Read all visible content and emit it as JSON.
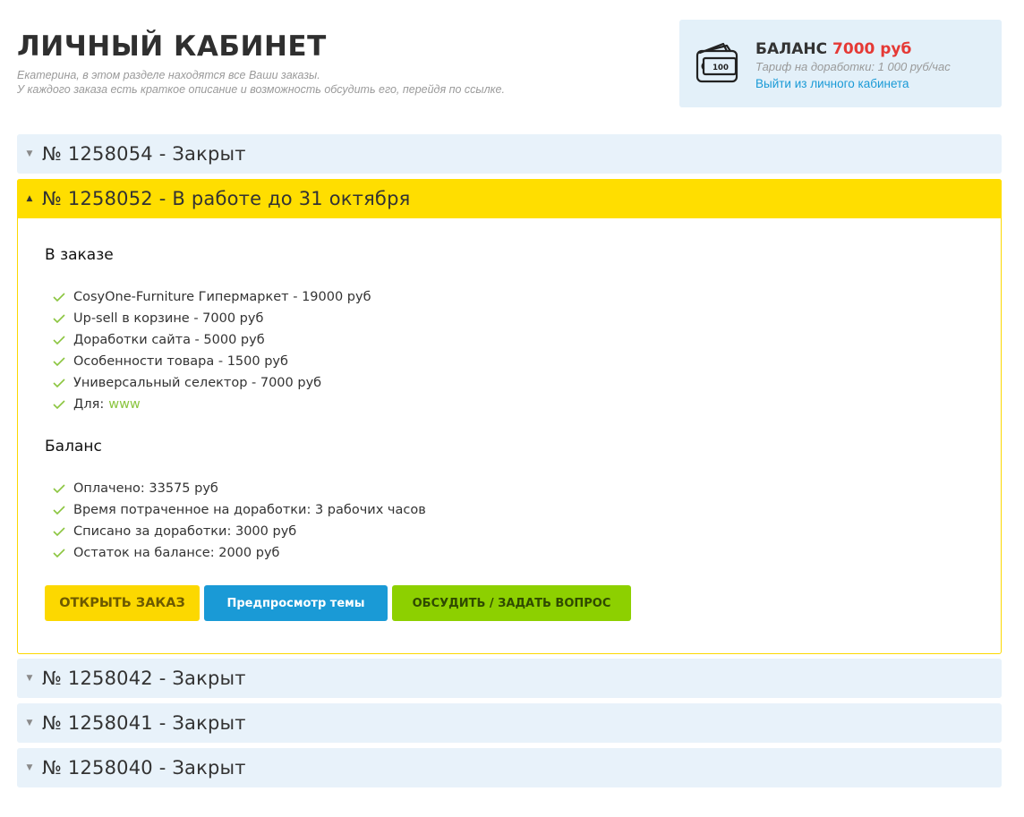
{
  "header": {
    "title": "ЛИЧНЫЙ КАБИНЕТ",
    "subtitle_line1": "Екатерина, в этом разделе находятся все Ваши заказы.",
    "subtitle_line2": "У каждого заказа есть краткое описание и возможность обсудить его, перейдя по ссылке."
  },
  "balance": {
    "label": "БАЛАНС",
    "amount": "7000 руб",
    "tariff": "Тариф на доработки: 1 000 руб/час",
    "logout": "Выйти из личного кабинета",
    "icon": "wallet-icon",
    "banknote_text": "100"
  },
  "orders": [
    {
      "title": "№ 1258054 - Закрыт"
    },
    {
      "title": "№ 1258052 - В работе до 31 октября"
    },
    {
      "title": "№ 1258042 - Закрыт"
    },
    {
      "title": "№ 1258041 - Закрыт"
    },
    {
      "title": "№ 1258040 - Закрыт"
    }
  ],
  "open_order": {
    "in_order_heading": "В заказе",
    "items": [
      "CosyOne-Furniture Гипермаркет - 19000 руб",
      "Up-sell в корзине - 7000 руб",
      "Доработки сайта - 5000 руб",
      "Особенности товара - 1500 руб",
      "Универсальный селектор - 7000 руб"
    ],
    "for_label": "Для:",
    "for_link": "www",
    "balance_heading": "Баланс",
    "balance_items": [
      "Оплачено: 33575 руб",
      "Время потраченное на доработки: 3 рабочих часов",
      "Списано за доработки: 3000 руб",
      "Остаток на балансе: 2000 руб"
    ],
    "buttons": {
      "open": "ОТКРЫТЬ ЗАКАЗ",
      "preview": "Предпросмотр темы",
      "discuss": "ОБСУДИТЬ / ЗАДАТЬ ВОПРОС"
    }
  },
  "colors": {
    "accent_yellow": "#ffde00",
    "balance_red": "#e53935",
    "link_blue": "#1a9ad6",
    "check_green": "#8bc53f",
    "panel_blue": "#e8f2fa"
  }
}
